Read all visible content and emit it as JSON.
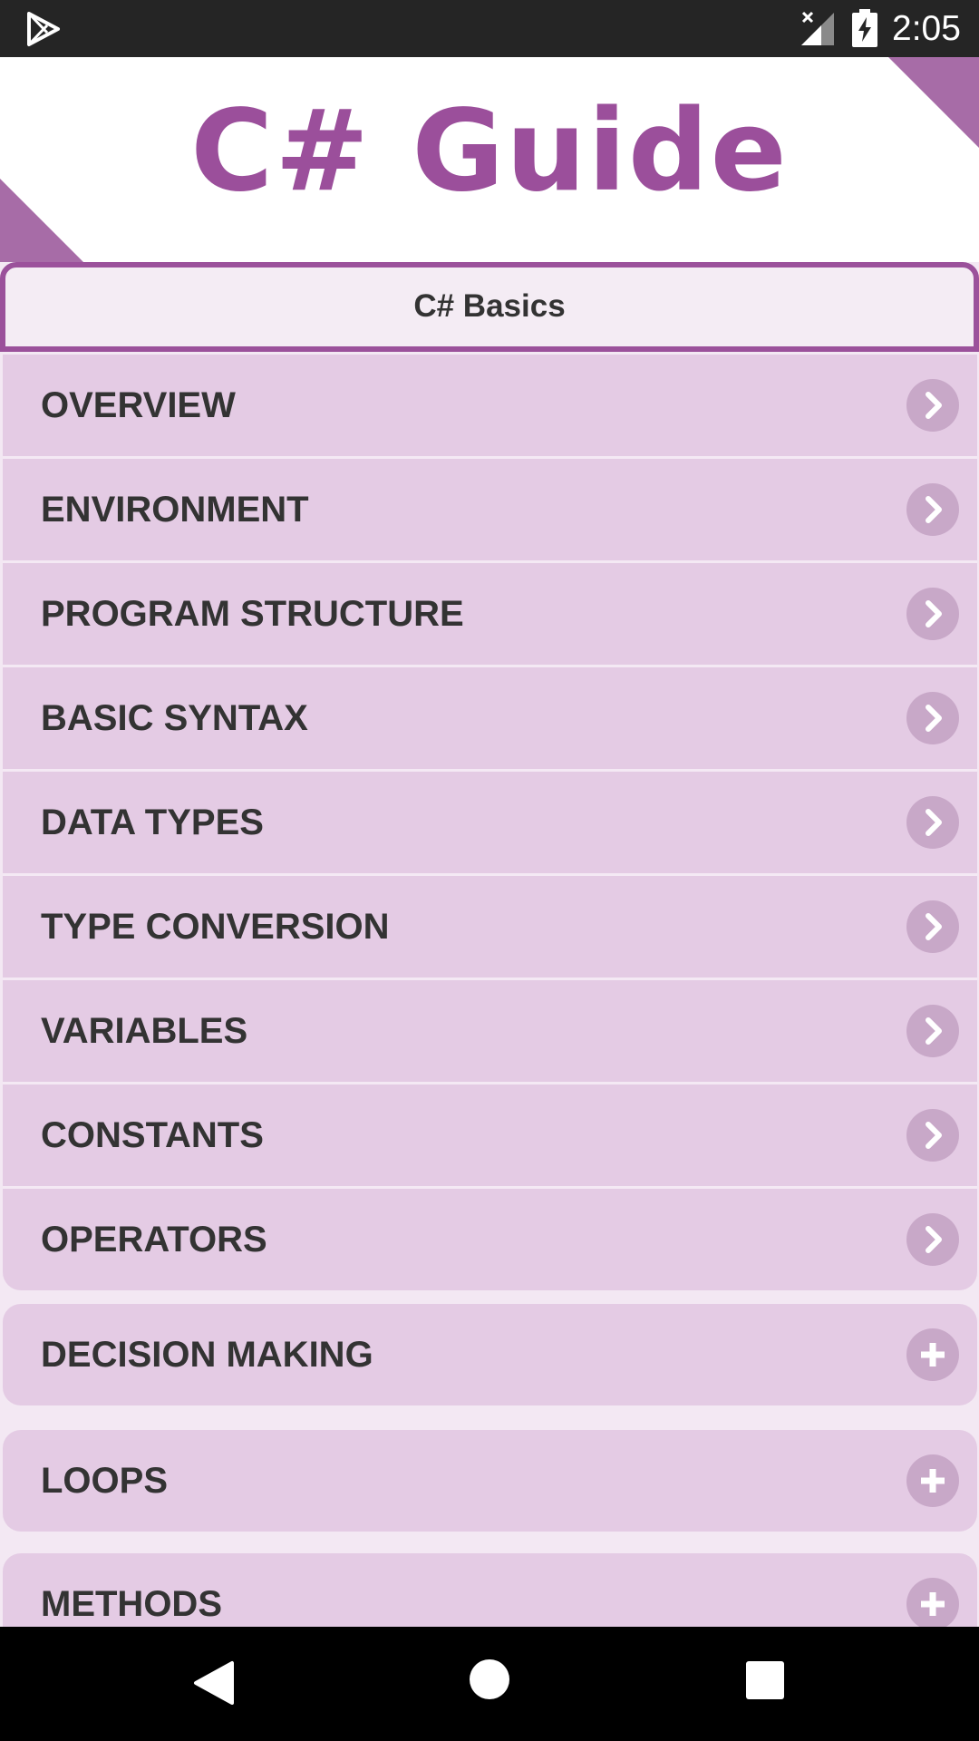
{
  "status_bar": {
    "time": "2:05",
    "icons": [
      "play-store-icon",
      "signal-off-icon",
      "battery-charging-icon"
    ]
  },
  "header": {
    "title": "C# Guide"
  },
  "section_tab": {
    "label": "C# Basics"
  },
  "topics": [
    {
      "label": "OVERVIEW",
      "icon": "chevron-right-icon"
    },
    {
      "label": "ENVIRONMENT",
      "icon": "chevron-right-icon"
    },
    {
      "label": "PROGRAM STRUCTURE",
      "icon": "chevron-right-icon"
    },
    {
      "label": "BASIC SYNTAX",
      "icon": "chevron-right-icon"
    },
    {
      "label": "DATA TYPES",
      "icon": "chevron-right-icon"
    },
    {
      "label": "TYPE CONVERSION",
      "icon": "chevron-right-icon"
    },
    {
      "label": "VARIABLES",
      "icon": "chevron-right-icon"
    },
    {
      "label": "CONSTANTS",
      "icon": "chevron-right-icon"
    },
    {
      "label": "OPERATORS",
      "icon": "chevron-right-icon"
    }
  ],
  "groups": [
    {
      "label": "DECISION MAKING",
      "icon": "plus-icon"
    },
    {
      "label": "LOOPS",
      "icon": "plus-icon"
    },
    {
      "label": "METHODS",
      "icon": "plus-icon"
    }
  ],
  "nav_bar": {
    "icons": [
      "back-icon",
      "home-icon",
      "recent-apps-icon"
    ]
  },
  "colors": {
    "brand_purple": "#9b4f9b",
    "row_background": "#e4cbe4",
    "page_background": "#f3e8f3",
    "icon_circle": "#c8a8c8"
  }
}
